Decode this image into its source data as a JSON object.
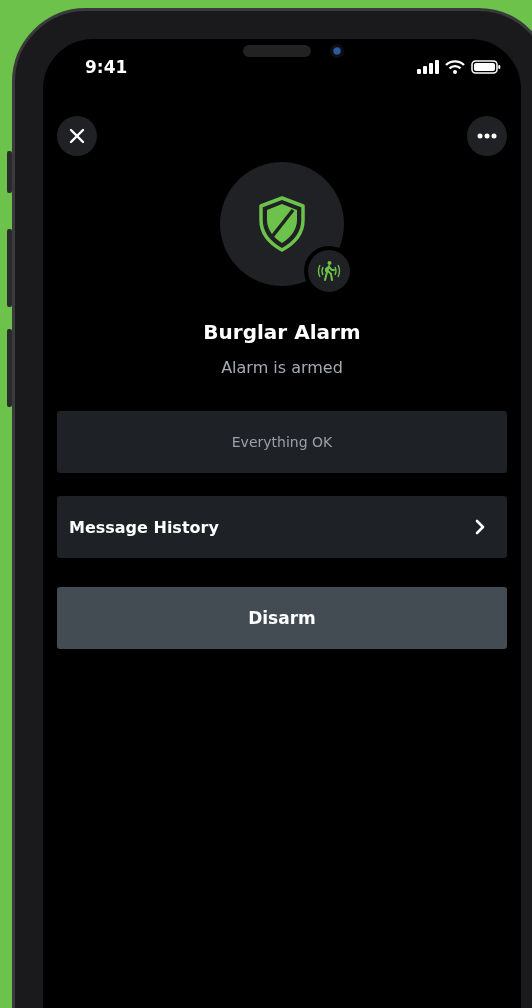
{
  "status_bar": {
    "time": "9:41"
  },
  "device": {
    "name": "Burglar Alarm",
    "status": "Alarm is armed"
  },
  "status_card": {
    "text": "Everything OK"
  },
  "menu_items": [
    {
      "label": "Message History"
    }
  ],
  "action_button": {
    "label": "Disarm"
  }
}
